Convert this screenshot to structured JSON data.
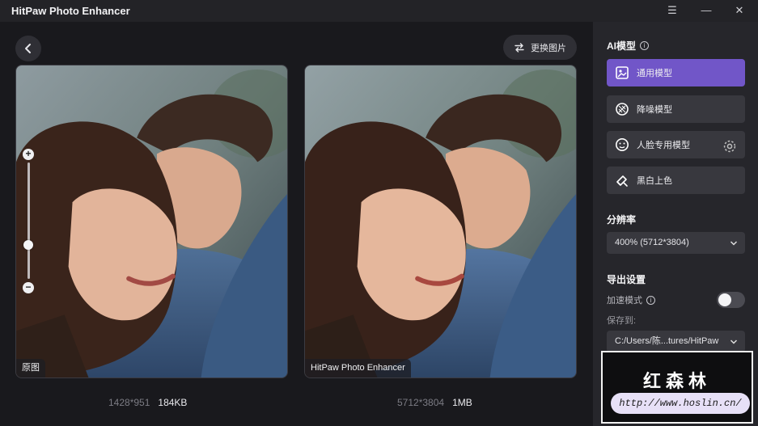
{
  "app": {
    "title": "HitPaw Photo Enhancer"
  },
  "window_controls": {
    "menu_icon": "menu-icon",
    "minimize_icon": "minimize-icon",
    "close_icon": "close-icon"
  },
  "toolbar": {
    "replace_label": "更换图片"
  },
  "original": {
    "tag": "原图",
    "dimensions": "1428*951",
    "size": "184KB"
  },
  "enhanced": {
    "tag": "HitPaw Photo Enhancer",
    "dimensions": "5712*3804",
    "size": "1MB"
  },
  "zoom": {
    "level_fraction": 0.3
  },
  "sidebar": {
    "ai_model_title": "AI模型",
    "models": [
      {
        "label": "通用模型",
        "icon": "image-icon",
        "active": true
      },
      {
        "label": "降噪模型",
        "icon": "denoise-icon",
        "active": false
      },
      {
        "label": "人脸专用模型",
        "icon": "face-icon",
        "active": false
      },
      {
        "label": "黑白上色",
        "icon": "colorize-icon",
        "active": false
      }
    ],
    "resolution_title": "分辨率",
    "resolution_value": "400% (5712*3804)",
    "export_title": "导出设置",
    "accelerate_label": "加速模式",
    "accelerate_on": false,
    "save_to_label": "保存到:",
    "save_path": "C:/Users/陈...tures/HitPaw"
  },
  "watermark": {
    "title": "红森林",
    "url": "http://www.hoslin.cn/"
  },
  "colors": {
    "accent": "#7156c8",
    "background": "#19191d",
    "sidebar": "#26262b"
  }
}
